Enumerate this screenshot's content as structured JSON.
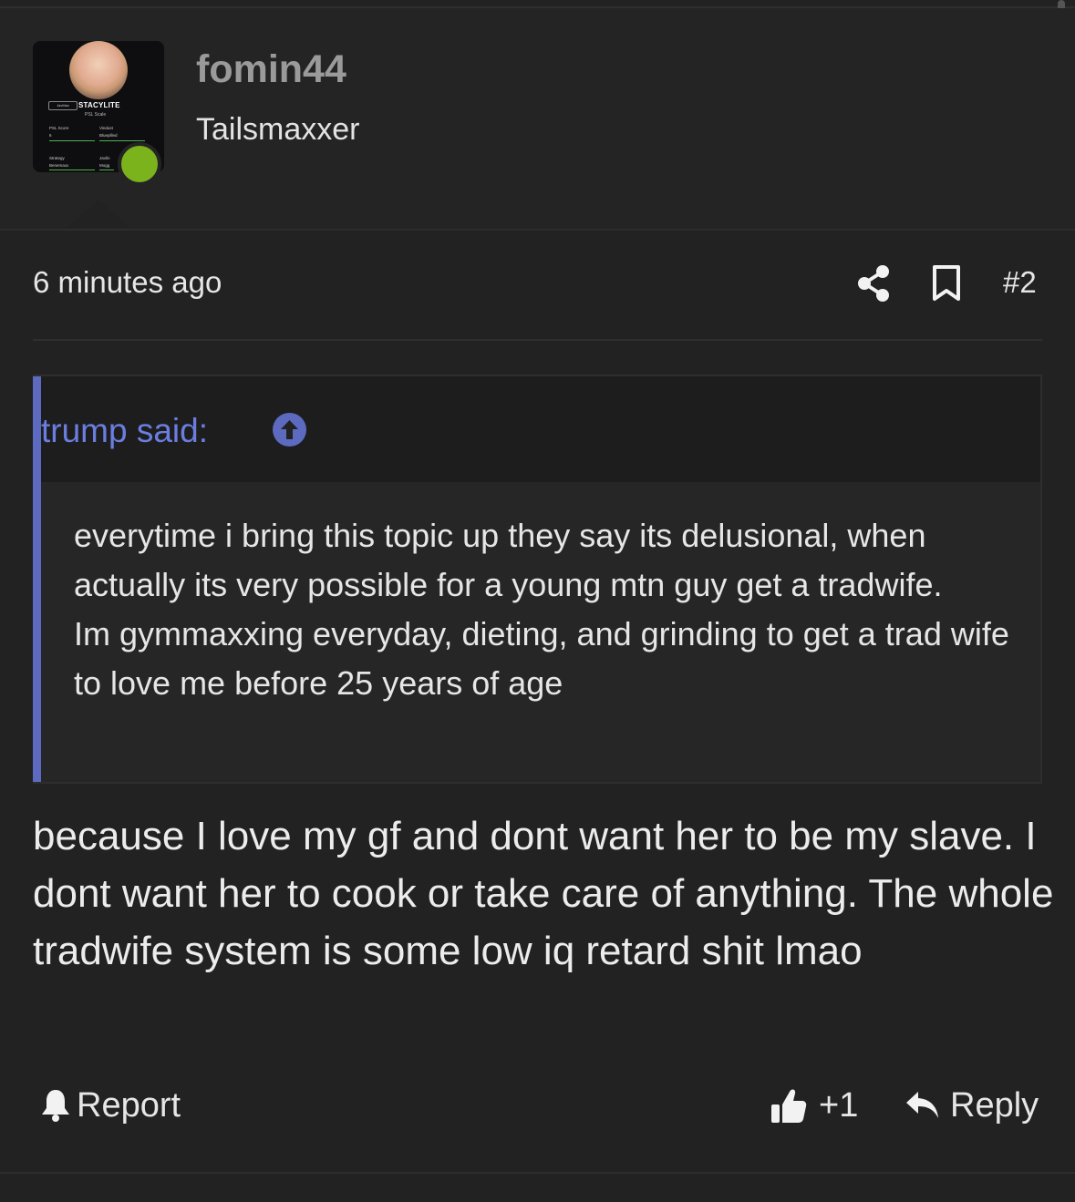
{
  "user": {
    "name": "fomin44",
    "title": "Tailsmaxxer",
    "avatar_card": {
      "tag": "JavMax",
      "title": "STACYLITE",
      "subtitle": "PSL Scale",
      "cells": [
        "PSL Score",
        "Vindust",
        "6",
        "Bluepilled",
        "Strategy",
        "Javlin",
        "Benemaxx",
        "Mogg"
      ]
    },
    "online_color": "#7bb31c"
  },
  "post": {
    "time": "6 minutes ago",
    "number": "#2",
    "icons": [
      "share-icon",
      "bookmark-icon"
    ]
  },
  "quote": {
    "author": "trump said:",
    "accent_color": "#5c6bc0",
    "lines": [
      "everytime i bring this topic up they say its delusional, when actually its very possible for a young mtn guy get a tradwife.",
      "Im gymmaxxing everyday, dieting, and grinding to get a trad wife to love me before 25 years of age"
    ]
  },
  "body": "because I love my gf and dont want her to be my slave. I dont want her to cook or take care of anything. The whole tradwife system is some low iq retard shit lmao",
  "actions": {
    "report": "Report",
    "like_count": "+1",
    "reply": "Reply"
  }
}
